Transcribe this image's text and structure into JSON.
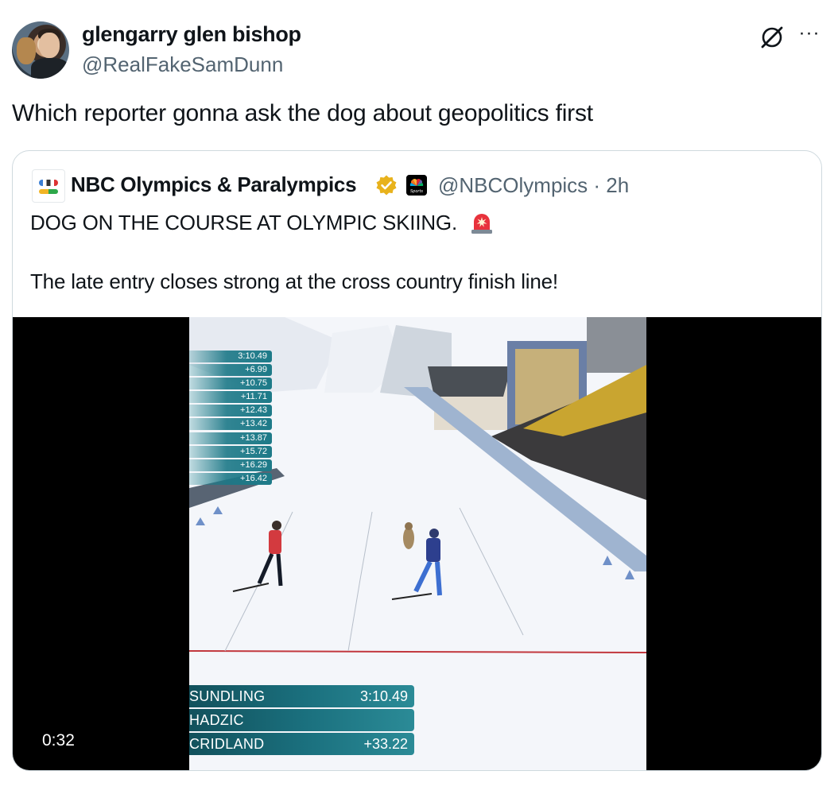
{
  "post": {
    "display_name": "glengarry glen bishop",
    "handle": "@RealFakeSamDunn",
    "text": "Which reporter gonna ask the dog about geopolitics first",
    "more_label": "···"
  },
  "quote": {
    "display_name": "NBC Olympics & Paralympics",
    "handle_time": "@NBCOlympics · 2h",
    "line1": "DOG ON THE COURSE AT OLYMPIC SKIING.",
    "line2": "The late entry closes strong at the cross country finish line!"
  },
  "video": {
    "duration": "0:32",
    "split_times": [
      "3:10.49",
      "+6.99",
      "+10.75",
      "+11.71",
      "+12.43",
      "+13.42",
      "+13.87",
      "+15.72",
      "+16.29",
      "+16.42"
    ],
    "results": [
      {
        "name": "SUNDLING",
        "time": "3:10.49"
      },
      {
        "name": "HADZIC",
        "time": ""
      },
      {
        "name": "CRIDLAND",
        "time": "+33.22"
      }
    ]
  },
  "icons": {
    "grok": "grok-icon",
    "more": "more-icon",
    "verified": "verified-badge-icon",
    "siren": "siren-emoji-icon"
  },
  "colors": {
    "text": "#0f1419",
    "secondary": "#536471",
    "border": "#cfd9de",
    "verified_gold": "#e8b21c"
  }
}
